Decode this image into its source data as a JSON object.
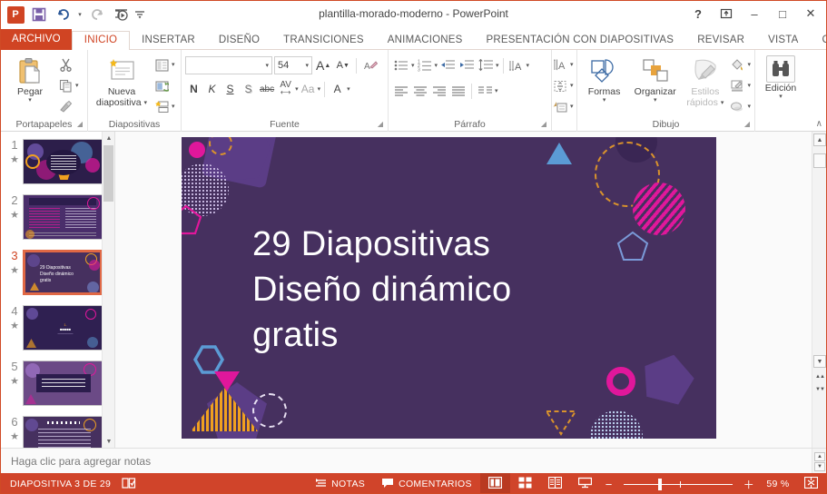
{
  "window": {
    "title": "plantilla-morado-moderno - PowerPoint",
    "logo_text": "P",
    "qat": [
      {
        "name": "save-icon",
        "glyph": "💾"
      },
      {
        "name": "undo-icon",
        "glyph": "↶"
      },
      {
        "name": "undo-dropdown-icon",
        "glyph": "▾"
      },
      {
        "name": "redo-icon",
        "glyph": "↻"
      },
      {
        "name": "start-slideshow-icon",
        "glyph": "▷"
      },
      {
        "name": "customize-qat-icon",
        "glyph": "☲"
      }
    ],
    "buttons": {
      "help": "?",
      "ribbon_display": "⤒",
      "minimize": "–",
      "maximize": "□",
      "close": "✕"
    }
  },
  "tabs": [
    {
      "label": "ARCHIVO",
      "kind": "file"
    },
    {
      "label": "INICIO",
      "kind": "active"
    },
    {
      "label": "INSERTAR",
      "kind": "normal"
    },
    {
      "label": "DISEÑO",
      "kind": "normal"
    },
    {
      "label": "TRANSICIONES",
      "kind": "normal"
    },
    {
      "label": "ANIMACIONES",
      "kind": "normal"
    },
    {
      "label": "PRESENTACIÓN CON DIAPOSITIVAS",
      "kind": "normal"
    },
    {
      "label": "REVISAR",
      "kind": "normal"
    },
    {
      "label": "VISTA",
      "kind": "normal"
    },
    {
      "label": "COM",
      "kind": "normal"
    }
  ],
  "ribbon": {
    "collapse_glyph": "∧",
    "groups": {
      "clipboard": {
        "label": "Portapapeles",
        "paste_label": "Pegar",
        "cut_title": "Cortar",
        "copy_title": "Copiar",
        "format_painter_title": "Copiar formato"
      },
      "slides": {
        "label": "Diapositivas",
        "new_slide_label_line1": "Nueva",
        "new_slide_label_line2": "diapositiva",
        "layout_title": "Diseño",
        "reset_title": "Restablecer",
        "section_title": "Sección"
      },
      "font": {
        "label": "Fuente",
        "font_name_value": "",
        "font_size_value": "54",
        "grow_font": "A",
        "shrink_font": "A",
        "clear_format": "✐",
        "bold": "N",
        "italic": "K",
        "underline": "S",
        "shadow": "S",
        "strikethrough": "abc",
        "spacing": "AV",
        "change_case": "Aa",
        "font_color": "A"
      },
      "paragraph": {
        "label": "Párrafo",
        "bullets_title": "Viñetas",
        "numbering_title": "Numeración",
        "decrease_indent_title": "Disminuir nivel de lista",
        "increase_indent_title": "Aumentar nivel de lista",
        "line_spacing_title": "Interlineado",
        "text_direction_title": "Dirección del texto",
        "align_text_title": "Alinear texto",
        "convert_smartart_title": "Convertir en SmartArt",
        "align_left_title": "Alinear a la izquierda",
        "align_center_title": "Centrar",
        "align_right_title": "Alinear a la derecha",
        "justify_title": "Justificar",
        "columns_title": "Columnas"
      },
      "drawing": {
        "label": "Dibujo",
        "shapes_label": "Formas",
        "arrange_label": "Organizar",
        "quick_styles_line1": "Estilos",
        "quick_styles_line2": "rápidos",
        "shape_fill_title": "Relleno de forma",
        "shape_outline_title": "Contorno de forma",
        "shape_effects_title": "Efectos de forma"
      },
      "editing": {
        "label": "Edición",
        "button_label": "Edición"
      }
    }
  },
  "thumbnails": {
    "scroll_up": "▲",
    "scroll_down": "▼",
    "slides": [
      {
        "number": "1",
        "star": "★",
        "selected": false
      },
      {
        "number": "2",
        "star": "★",
        "selected": false
      },
      {
        "number": "3",
        "star": "★",
        "selected": true
      },
      {
        "number": "4",
        "star": "★",
        "selected": false
      },
      {
        "number": "5",
        "star": "★",
        "selected": false
      },
      {
        "number": "6",
        "star": "★",
        "selected": false
      }
    ]
  },
  "slide": {
    "title_line1": "29 Diapositivas",
    "title_line2": "Diseño dinámico",
    "title_line3": "gratis",
    "background_color": "#46305f",
    "accent_magenta": "#e0179b",
    "accent_orange": "#f0a020",
    "accent_blue": "#5b9bd5",
    "accent_purple": "#5b3d86"
  },
  "notes": {
    "placeholder": "Haga clic para agregar notas"
  },
  "right_scrollbar": {
    "up": "▲",
    "down": "▼",
    "prev_slide": "▲▲",
    "next_slide": "▼▼"
  },
  "status_bar": {
    "slide_counter": "DIAPOSITIVA 3 DE 29",
    "language_icon": "📖",
    "notes_label": "NOTAS",
    "notes_icon": "☰",
    "comments_label": "COMENTARIOS",
    "comments_icon": "💬",
    "view_normal_icon": "▤",
    "view_sorter_icon": "▦",
    "view_reading_icon": "▥",
    "view_slideshow_icon": "▷",
    "zoom_out": "−",
    "zoom_in": "＋",
    "zoom_value": "59 %",
    "fit_to_window_icon": "⤢"
  }
}
